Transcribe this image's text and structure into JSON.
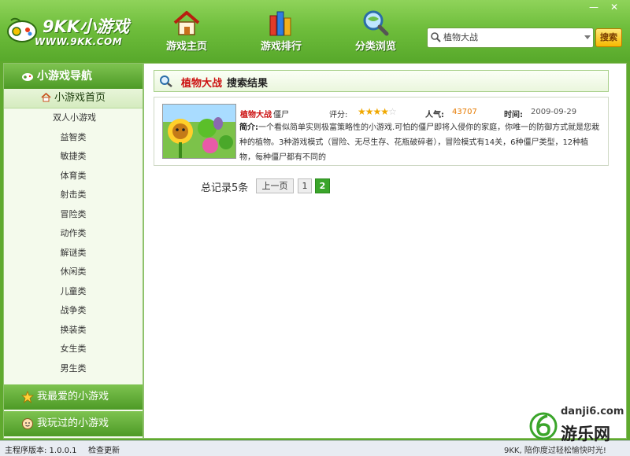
{
  "app": {
    "logo_name": "9KK小游戏",
    "logo_url": "WWW.9KK.COM"
  },
  "nav": [
    {
      "label": "游戏主页",
      "icon": "house-icon"
    },
    {
      "label": "游戏排行",
      "icon": "ranking-books-icon"
    },
    {
      "label": "分类浏览",
      "icon": "magnifier-globe-icon"
    }
  ],
  "window_controls": {
    "minimize": "—",
    "close": "✕"
  },
  "search": {
    "value": "植物大战",
    "button": "搜索"
  },
  "sidebar": {
    "header": "小游戏导航",
    "home": "小游戏首页",
    "categories": [
      "双人小游戏",
      "益智类",
      "敏捷类",
      "体育类",
      "射击类",
      "冒险类",
      "动作类",
      "解谜类",
      "休闲类",
      "儿童类",
      "战争类",
      "换装类",
      "女生类",
      "男生类"
    ],
    "favorites": "我最爱的小游戏",
    "played": "我玩过的小游戏"
  },
  "results": {
    "keyword": "植物大战",
    "suffix": "搜索结果",
    "items": [
      {
        "name": "植物大战",
        "name_suffix": "僵尸",
        "rating_label": "评分:",
        "stars": 4,
        "stars_max": 5,
        "popularity_label": "人气:",
        "popularity": "43707",
        "time_label": "时间:",
        "time": "2009-09-29",
        "desc_label": "简介:",
        "desc": "一个看似简单实则极富策略性的小游戏.可怕的僵尸即将入侵你的家庭，你唯一的防御方式就是您栽种的植物。3种游戏模式（冒险、无尽生存、花瓶破碎者），冒险模式有14关，6种僵尸类型，12种植物，每种僵尸都有不同的"
      }
    ]
  },
  "pager": {
    "total": "总记录5条",
    "prev": "上一页",
    "pages": [
      "1",
      "2"
    ],
    "current": "2"
  },
  "status": {
    "version": "主程序版本: 1.0.0.1",
    "update": "检查更新",
    "message": "9KK, 陪你度过轻松愉快时光!"
  },
  "watermark": {
    "domain": "danji6.com",
    "brand": "游乐网"
  },
  "colors": {
    "brand_green": "#5fa92e",
    "keyword_red": "#cc1111",
    "popularity_orange": "#e67a00",
    "star_gold": "#f0a800"
  }
}
